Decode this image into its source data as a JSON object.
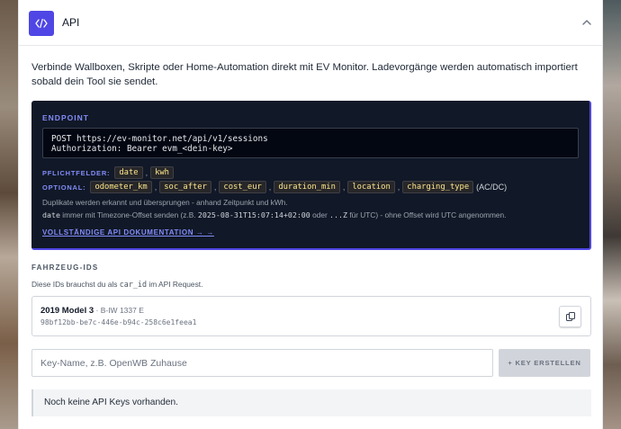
{
  "header": {
    "badge_glyph": "</>",
    "title": "API",
    "collapse_icon": "chevron-up-icon"
  },
  "intro": "Verbinde Wallboxen, Skripte oder Home-Automation direkt mit EV Monitor. Ladevorgänge werden automatisch importiert sobald dein Tool sie sendet.",
  "endpoint": {
    "label": "ENDPOINT",
    "request_line": "POST https://ev-monitor.net/api/v1/sessions",
    "auth_line": "Authorization: Bearer evm_<dein-key>",
    "required_label": "PFLICHTFELDER:",
    "required_fields": [
      "date",
      "kwh"
    ],
    "optional_label": "OPTIONAL:",
    "optional_fields": [
      "odometer_km",
      "soc_after",
      "cost_eur",
      "duration_min",
      "location",
      "charging_type"
    ],
    "charging_type_hint": "(AC/DC)",
    "note_duplicates": "Duplikate werden erkannt und übersprungen - anhand Zeitpunkt und kWh.",
    "note_date_code": "date",
    "note_date_text": " immer mit Timezone-Offset senden (z.B. ",
    "note_date_example": "2025-08-31T15:07:14+02:00",
    "note_date_or": " oder ",
    "note_date_z": "...Z",
    "note_date_rest": " für UTC) - ohne Offset wird UTC angenommen.",
    "docs_link": "VOLLSTÄNDIGE API DOKUMENTATION → →"
  },
  "vehicles": {
    "title": "FAHRZEUG-IDS",
    "subtitle_pre": "Diese IDs brauchst du als ",
    "subtitle_code": "car_id",
    "subtitle_post": " im API Request.",
    "items": [
      {
        "name": "2019 Model 3",
        "plate": " · B-IW 1337 E",
        "id": "98bf12bb-be7c-446e-b94c-258c6e1feea1",
        "copy_icon": "copy-icon"
      }
    ]
  },
  "api_keys": {
    "input_placeholder": "Key-Name, z.B. OpenWB Zuhause",
    "input_value": "",
    "create_button": "+ KEY ERSTELLEN",
    "empty_state": "Noch keine API Keys vorhanden."
  },
  "colors": {
    "accent": "#4f46e5",
    "code_bg": "#111827",
    "chip_text": "#fde68a"
  }
}
